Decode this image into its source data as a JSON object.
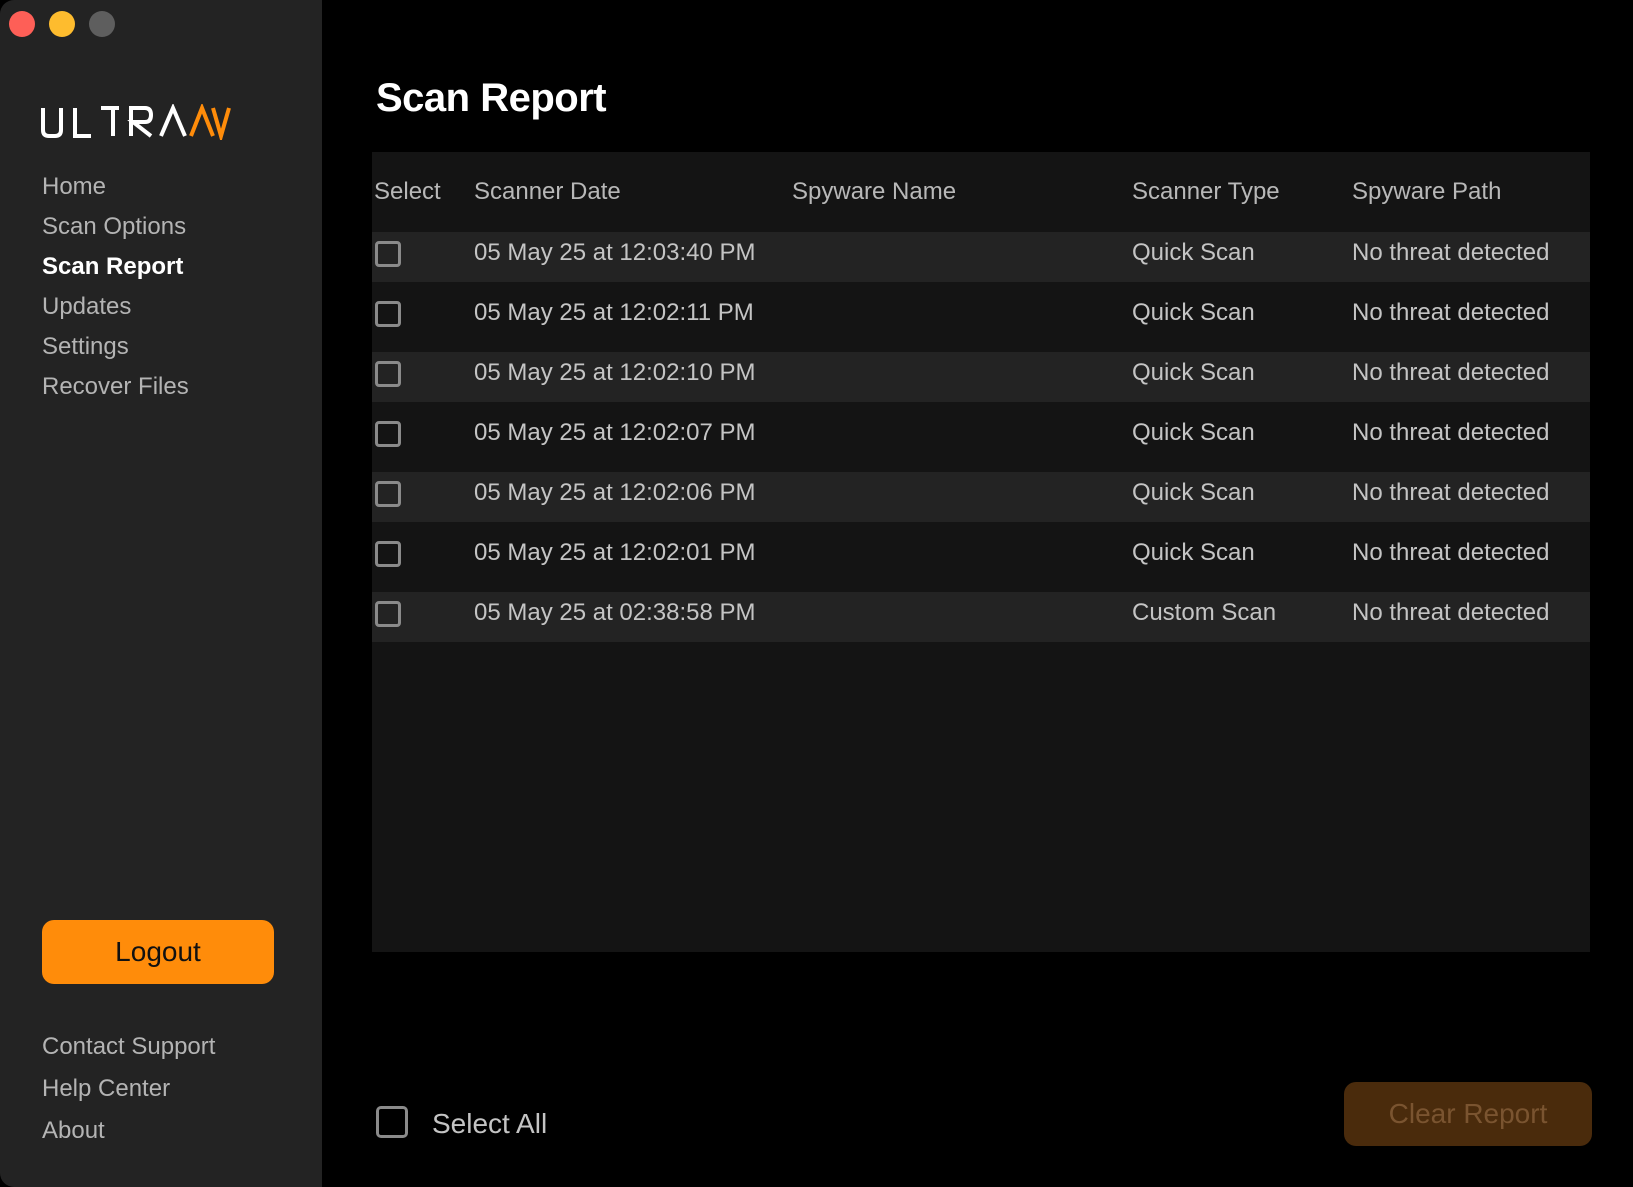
{
  "window": {
    "controls": [
      "close",
      "minimize",
      "zoom"
    ]
  },
  "sidebar": {
    "logo_text": "ULTRAAV",
    "nav": [
      {
        "label": "Home",
        "active": false
      },
      {
        "label": "Scan Options",
        "active": false
      },
      {
        "label": "Scan Report",
        "active": true
      },
      {
        "label": "Updates",
        "active": false
      },
      {
        "label": "Settings",
        "active": false
      },
      {
        "label": "Recover Files",
        "active": false
      }
    ],
    "logout_label": "Logout",
    "footer_links": [
      "Contact Support",
      "Help Center",
      "About"
    ]
  },
  "main": {
    "title": "Scan Report",
    "columns": {
      "select": "Select",
      "date": "Scanner Date",
      "name": "Spyware Name",
      "type": "Scanner Type",
      "path": "Spyware Path"
    },
    "rows": [
      {
        "checked": false,
        "date": "05 May 25 at 12:03:40 PM",
        "name": "",
        "type": "Quick Scan",
        "path": "No threat detected"
      },
      {
        "checked": false,
        "date": "05 May 25 at 12:02:11 PM",
        "name": "",
        "type": "Quick Scan",
        "path": "No threat detected"
      },
      {
        "checked": false,
        "date": "05 May 25 at 12:02:10 PM",
        "name": "",
        "type": "Quick Scan",
        "path": "No threat detected"
      },
      {
        "checked": false,
        "date": "05 May 25 at 12:02:07 PM",
        "name": "",
        "type": "Quick Scan",
        "path": "No threat detected"
      },
      {
        "checked": false,
        "date": "05 May 25 at 12:02:06 PM",
        "name": "",
        "type": "Quick Scan",
        "path": "No threat detected"
      },
      {
        "checked": false,
        "date": "05 May 25 at 12:02:01 PM",
        "name": "",
        "type": "Quick Scan",
        "path": "No threat detected"
      },
      {
        "checked": false,
        "date": "05 May 25 at 02:38:58 PM",
        "name": "",
        "type": "Custom Scan",
        "path": "No threat detected"
      }
    ],
    "select_all_label": "Select All",
    "select_all_checked": false,
    "clear_report_label": "Clear Report",
    "clear_report_enabled": false
  },
  "colors": {
    "accent": "#ff8c0a",
    "accent_disabled": "#4a2b0c",
    "sidebar_bg": "#232323",
    "main_bg": "#000000",
    "table_bg": "#141414",
    "row_alt_bg": "#232323"
  }
}
